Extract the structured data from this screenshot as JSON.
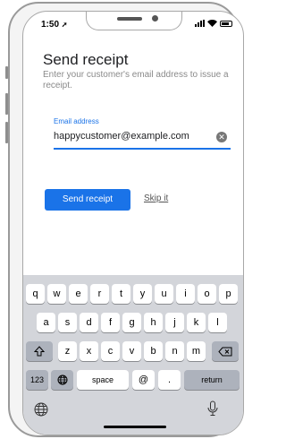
{
  "status_bar": {
    "time": "1:50"
  },
  "header": {
    "title": "Send receipt",
    "subtitle": "Enter your customer's email address to issue a receipt."
  },
  "email_field": {
    "label": "Email address",
    "value": "happycustomer@example.com",
    "clear_icon": "clear-circle-icon"
  },
  "actions": {
    "send_label": "Send receipt",
    "skip_label": "Skip it"
  },
  "keyboard": {
    "row1": [
      "q",
      "w",
      "e",
      "r",
      "t",
      "y",
      "u",
      "i",
      "o",
      "p"
    ],
    "row2": [
      "a",
      "s",
      "d",
      "f",
      "g",
      "h",
      "j",
      "k",
      "l"
    ],
    "row3": [
      "z",
      "x",
      "c",
      "v",
      "b",
      "n",
      "m"
    ],
    "numbers_label": "123",
    "space_label": "space",
    "at_label": "@",
    "dot_label": ".",
    "return_label": "return"
  },
  "colors": {
    "accent": "#1a73e8",
    "keyboard_bg": "#d3d5da"
  }
}
